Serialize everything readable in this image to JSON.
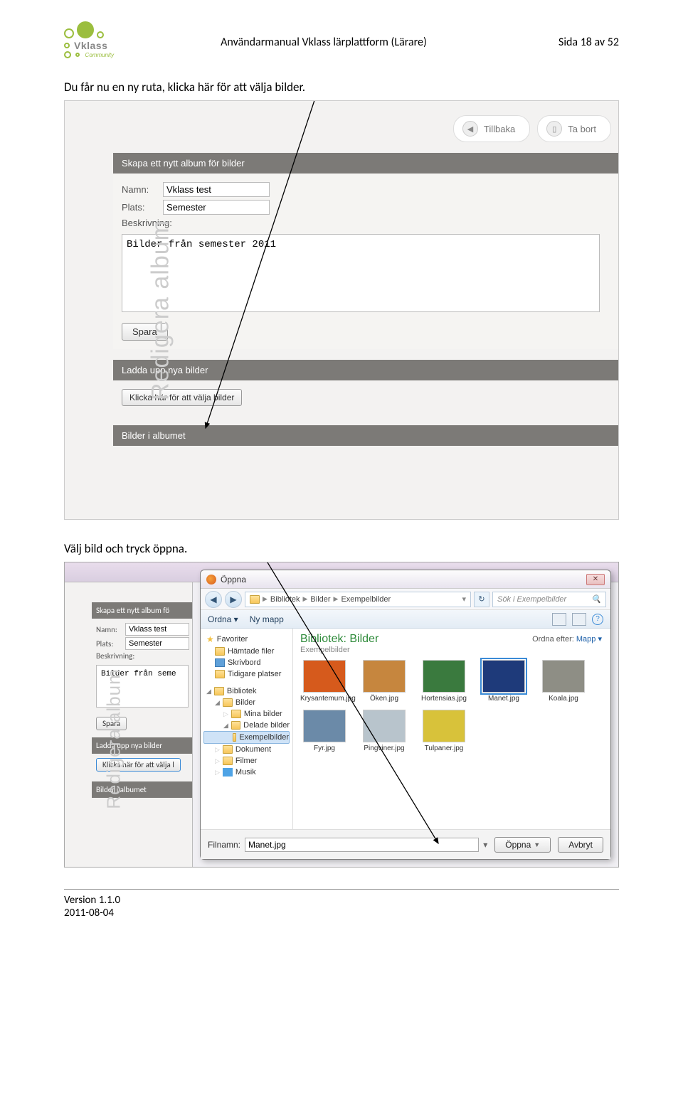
{
  "header": {
    "title": "Användarmanual Vklass lärplattform (Lärare)",
    "page": "Sida 18 av 52",
    "logo_name": "Vklass",
    "logo_sub": "Community"
  },
  "para1": "Du får nu en ny ruta, klicka här för att välja bilder.",
  "para2": "Välj bild och tryck öppna.",
  "sc1": {
    "side_label": "Redigera album",
    "back_btn": "Tillbaka",
    "delete_btn": "Ta bort",
    "bar1": "Skapa ett nytt album för bilder",
    "name_lbl": "Namn:",
    "name_val": "Vklass test",
    "place_lbl": "Plats:",
    "place_val": "Semester",
    "desc_lbl": "Beskrivning:",
    "desc_val": "Bilder från semester 2011",
    "save_btn": "Spara",
    "bar2": "Ladda upp nya bilder",
    "pick_btn": "Klicka här för att välja bilder",
    "bar3": "Bilder i albumet"
  },
  "sc2": {
    "side_label": "Redigera album",
    "bar1": "Skapa ett nytt album fö",
    "name_lbl": "Namn:",
    "name_val": "Vklass test",
    "place_lbl": "Plats:",
    "place_val": "Semester",
    "desc_lbl": "Beskrivning:",
    "desc_val": "Bilder från seme",
    "save_btn": "Spara",
    "bar2": "Ladda upp nya bilder",
    "pick_btn": "Klicka här för att välja l",
    "bar3": "Bilder i albumet"
  },
  "dialog": {
    "title": "Öppna",
    "breadcrumb": [
      "Bibliotek",
      "Bilder",
      "Exempelbilder"
    ],
    "search_placeholder": "Sök i Exempelbilder",
    "toolbar": {
      "organize": "Ordna ▾",
      "newfolder": "Ny mapp"
    },
    "tree": {
      "fav": "Favoriter",
      "downloads": "Hämtade filer",
      "desktop": "Skrivbord",
      "recent": "Tidigare platser",
      "libraries": "Bibliotek",
      "pictures": "Bilder",
      "mypics": "Mina bilder",
      "shared": "Delade bilder",
      "sample": "Exempelbilder",
      "docs": "Dokument",
      "films": "Filmer",
      "music": "Musik"
    },
    "library_title": "Bibliotek: Bilder",
    "library_sub": "Exempelbilder",
    "sort_lbl": "Ordna efter:",
    "sort_val": "Mapp",
    "thumbs": [
      {
        "name": "Krysantemum.jpg",
        "color": "#d65a1c"
      },
      {
        "name": "Öken.jpg",
        "color": "#c6863e"
      },
      {
        "name": "Hortensias.jpg",
        "color": "#3a7a3e"
      },
      {
        "name": "Manet.jpg",
        "color": "#1e3a7a",
        "sel": true
      },
      {
        "name": "Koala.jpg",
        "color": "#8e8e85"
      },
      {
        "name": "Fyr.jpg",
        "color": "#6b8aa8"
      },
      {
        "name": "Pingviner.jpg",
        "color": "#b8c4cc"
      },
      {
        "name": "Tulpaner.jpg",
        "color": "#d8c23a"
      }
    ],
    "filename_lbl": "Filnamn:",
    "filename_val": "Manet.jpg",
    "open_btn": "Öppna",
    "cancel_btn": "Avbryt"
  },
  "footer": {
    "version": "Version 1.1.0",
    "date": "2011-08-04"
  }
}
